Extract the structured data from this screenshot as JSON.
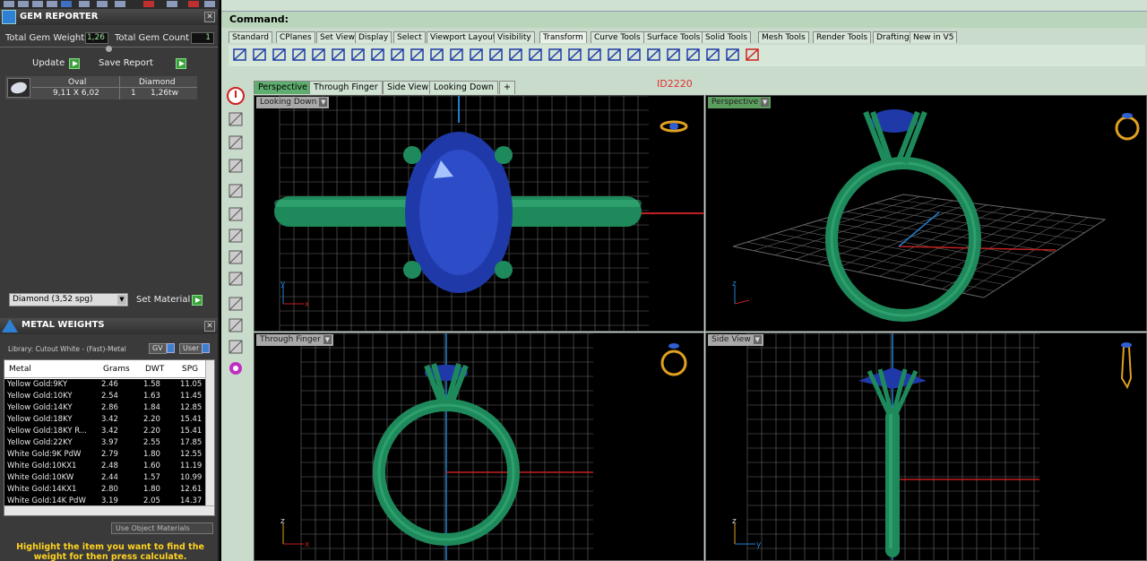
{
  "gem_reporter": {
    "title": "GEM REPORTER",
    "total_gem_weight_label": "Total Gem Weight",
    "total_gem_weight_value": "1,26",
    "total_gem_count_label": "Total Gem Count",
    "total_gem_count_value": "1",
    "update_label": "Update",
    "save_report_label": "Save Report",
    "gems": [
      {
        "shape": "Oval",
        "size": "9,11 X 6,02",
        "material": "Diamond",
        "count": "1",
        "weight": "1,26tw"
      }
    ],
    "material_select": "Diamond    (3,52 spg)",
    "set_material_label": "Set Material"
  },
  "metal_weights": {
    "title": "METAL WEIGHTS",
    "library": "Library: Cutout White - (Fast)-Metal",
    "gv_label": "GV",
    "user_label": "User",
    "columns": [
      "Metal",
      "Grams",
      "DWT",
      "SPG"
    ],
    "rows": [
      [
        "Yellow Gold:9KY",
        "2.46",
        "1.58",
        "11.05"
      ],
      [
        "Yellow Gold:10KY",
        "2.54",
        "1.63",
        "11.45"
      ],
      [
        "Yellow Gold:14KY",
        "2.86",
        "1.84",
        "12.85"
      ],
      [
        "Yellow Gold:18KY",
        "3.42",
        "2.20",
        "15.41"
      ],
      [
        "Yellow Gold:18KY R...",
        "3.42",
        "2.20",
        "15.41"
      ],
      [
        "Yellow Gold:22KY",
        "3.97",
        "2.55",
        "17.85"
      ],
      [
        "White Gold:9K PdW",
        "2.79",
        "1.80",
        "12.55"
      ],
      [
        "White Gold:10KX1",
        "2.48",
        "1.60",
        "11.19"
      ],
      [
        "White Gold:10KW",
        "2.44",
        "1.57",
        "10.99"
      ],
      [
        "White Gold:14KX1",
        "2.80",
        "1.80",
        "12.61"
      ],
      [
        "White Gold:14K PdW",
        "3.19",
        "2.05",
        "14.37"
      ]
    ],
    "use_object_materials": "Use Object Materials",
    "hint": "Highlight the item you want to find the weight for then press calculate."
  },
  "rhino": {
    "command_label": "Command:",
    "toolbar_tabs": [
      "Standard",
      "CPlanes",
      "Set View",
      "Display",
      "Select",
      "Viewport Layout",
      "Visibility",
      "Transform",
      "Curve Tools",
      "Surface Tools",
      "Solid Tools",
      "Mesh Tools",
      "Render Tools",
      "Drafting",
      "New in V5"
    ],
    "active_toolbar_tab": "Transform",
    "viewport_tabs": [
      "Perspective",
      "Through Finger",
      "Side View",
      "Looking Down"
    ],
    "active_viewport_tab": "Perspective",
    "id_tag": "ID2220",
    "viewports": {
      "top_left": "Looking Down",
      "top_right": "Perspective",
      "bottom_left": "Through Finger",
      "bottom_right": "Side View"
    },
    "axis_labels": {
      "x": "x",
      "y": "y",
      "z": "z"
    }
  },
  "colors": {
    "metal_green": "#1e8a5c",
    "gem_blue": "#1f3aa8",
    "grid": "#7a7a7a",
    "axis_red": "#c02020",
    "axis_blue": "#2080d0",
    "highlight_yellow": "#ffd21f"
  }
}
